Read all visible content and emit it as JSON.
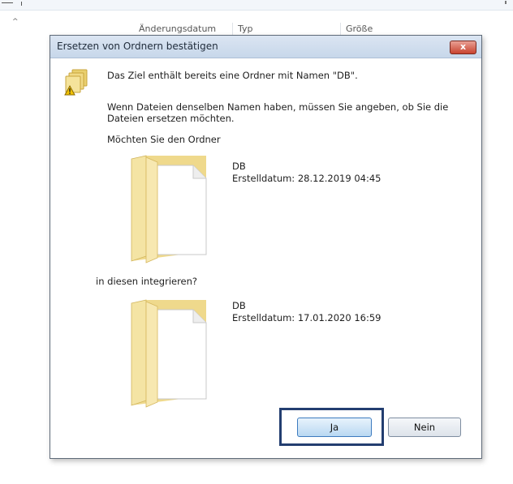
{
  "background": {
    "columns": [
      "Änderungsdatum",
      "Typ",
      "Größe"
    ],
    "sort_indicator": "^"
  },
  "dialog": {
    "title": "Ersetzen von Ordnern bestätigen",
    "close_label": "x",
    "message": "Das Ziel enthält bereits eine Ordner mit Namen \"DB\".",
    "info_line1": "Wenn Dateien denselben Namen haben, müssen Sie angeben, ob Sie die",
    "info_line2": "Dateien ersetzen möchten.",
    "question": "Möchten Sie den Ordner",
    "source": {
      "name": "DB",
      "created": "Erstelldatum: 28.12.2019 04:45"
    },
    "integrate_text": "in diesen integrieren?",
    "target": {
      "name": "DB",
      "created": "Erstelldatum: 17.01.2020 16:59"
    },
    "buttons": {
      "yes": "Ja",
      "no": "Nein"
    }
  },
  "colors": {
    "highlight_box": "#233e70",
    "title_bar": "#c7d7ea",
    "close_button": "#c8432f"
  }
}
